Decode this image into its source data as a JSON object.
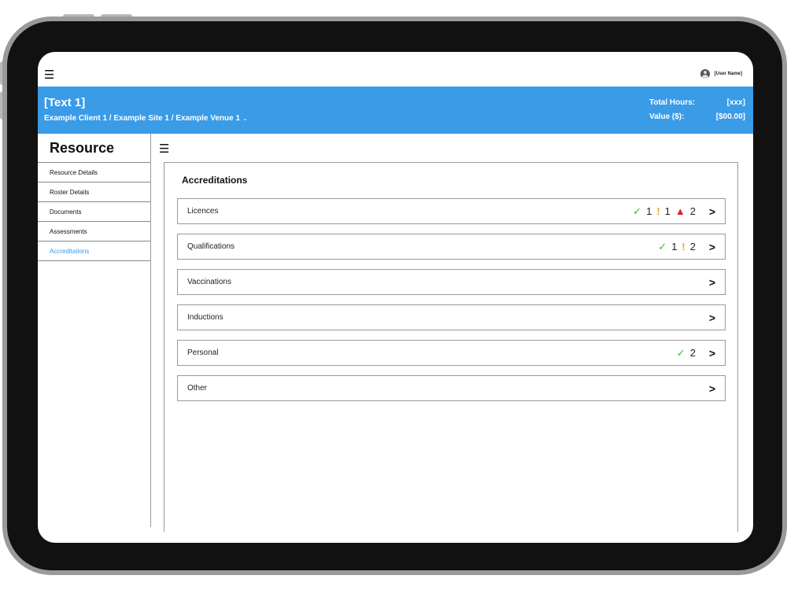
{
  "topbar": {
    "user_name": "[User Name]"
  },
  "header": {
    "title": "[Text 1]",
    "breadcrumb": "Example Client 1 / Example Site 1 / Example Venue 1",
    "total_hours_label": "Total Hours:",
    "total_hours_value": "[xxx]",
    "value_label": "Value ($):",
    "value_value": "[$00.00]",
    "header_color": "#3a9be6"
  },
  "sidebar": {
    "title": "Resource",
    "items": [
      {
        "label": "Resource Details",
        "active": false
      },
      {
        "label": "Roster Details",
        "active": false
      },
      {
        "label": "Documents",
        "active": false
      },
      {
        "label": "Assessments",
        "active": false
      },
      {
        "label": "Accreditations",
        "active": true
      }
    ]
  },
  "main": {
    "section_title": "Accreditations",
    "rows": [
      {
        "label": "Licences",
        "badges": [
          {
            "icon": "check-icon",
            "count": "1"
          },
          {
            "icon": "warning-icon",
            "count": "1"
          },
          {
            "icon": "alert-triangle-icon",
            "count": "2"
          }
        ]
      },
      {
        "label": "Qualifications",
        "badges": [
          {
            "icon": "check-icon",
            "count": "1"
          },
          {
            "icon": "warning-icon",
            "count": "2"
          }
        ]
      },
      {
        "label": "Vaccinations",
        "badges": []
      },
      {
        "label": "Inductions",
        "badges": []
      },
      {
        "label": "Personal",
        "badges": [
          {
            "icon": "check-icon",
            "count": "2"
          }
        ]
      },
      {
        "label": "Other",
        "badges": []
      }
    ]
  },
  "colors": {
    "check": "#2bbf3a",
    "warning": "#f0a020",
    "alert": "#e02020",
    "active_link": "#3a9be6"
  }
}
